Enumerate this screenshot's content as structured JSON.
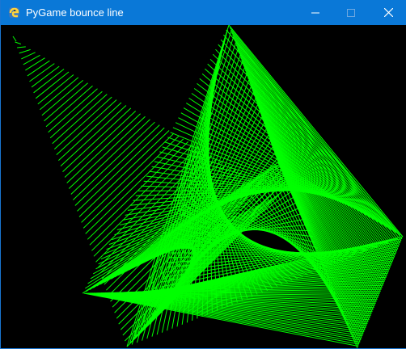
{
  "window": {
    "title": "PyGame bounce line",
    "buttons": {
      "minimize": "minimize",
      "maximize": "maximize",
      "close": "close"
    },
    "icon": "pygame-snake-icon"
  },
  "canvas": {
    "background": "#000000",
    "line_color": "#00ff00",
    "description_icon": "bouncing-line-trails"
  },
  "colors": {
    "titlebar": "#0a78d7",
    "titlebar_text": "#ffffff",
    "window_border": "#1976d2"
  }
}
